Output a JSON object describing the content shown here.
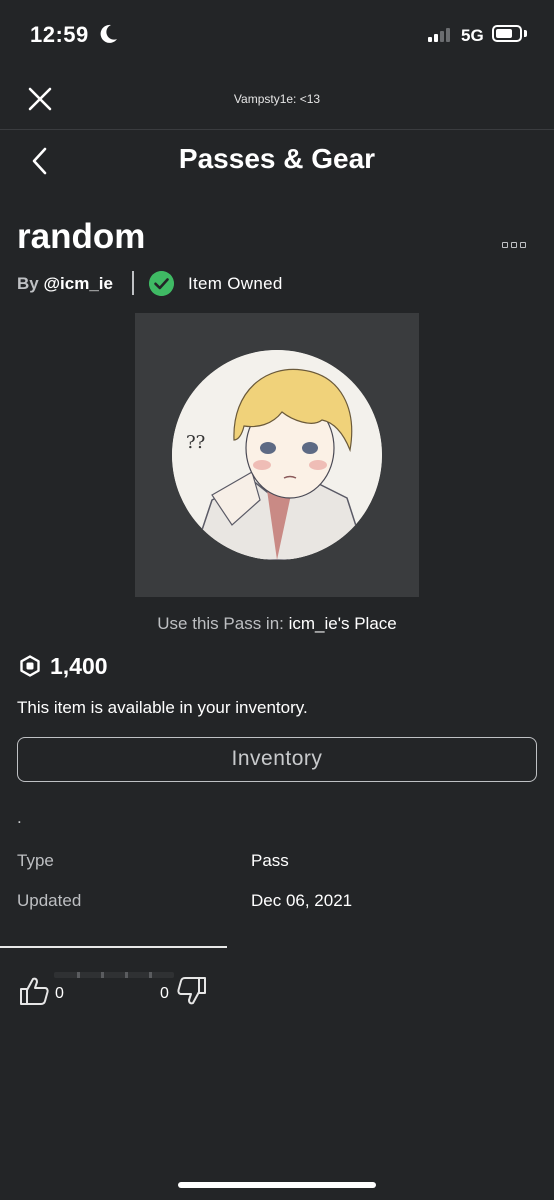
{
  "status_bar": {
    "time": "12:59",
    "network": "5G",
    "battery_level": 0.72,
    "signal_bars": 2
  },
  "top_bar": {
    "subtitle": "Vampsty1e: <13"
  },
  "header": {
    "title": "Passes & Gear"
  },
  "item": {
    "title": "random",
    "by_label": "By",
    "creator": "@icm_ie",
    "owned_label": "Item Owned",
    "use_pass_prefix": "Use this Pass in:",
    "place_name": "icm_ie's Place",
    "price": "1,400",
    "availability": "This item is available in your inventory.",
    "inventory_button": "Inventory",
    "description": "."
  },
  "details": [
    {
      "label": "Type",
      "value": "Pass"
    },
    {
      "label": "Updated",
      "value": "Dec 06, 2021"
    }
  ],
  "votes": {
    "up": "0",
    "down": "0"
  },
  "colors": {
    "background": "#232527",
    "owned_check": "#3fba64"
  }
}
